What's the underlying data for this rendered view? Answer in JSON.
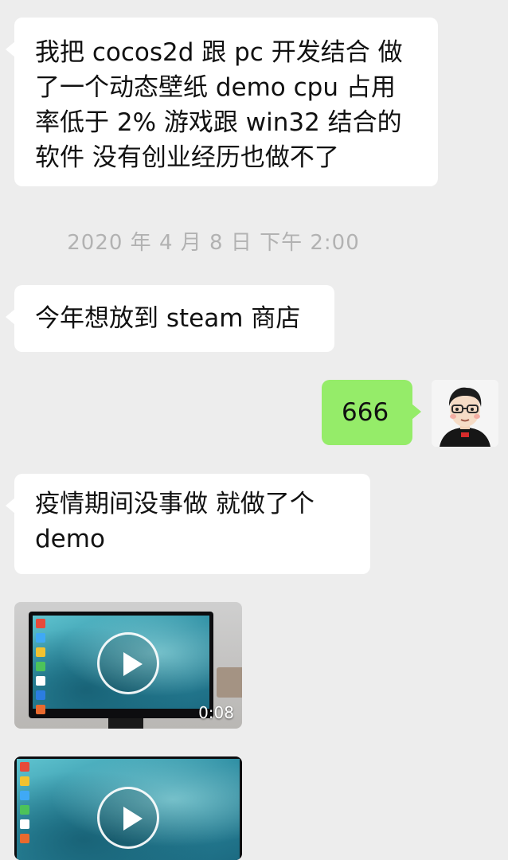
{
  "messages": {
    "msg1_text": "我把 cocos2d 跟 pc 开发结合 做\n了一个动态壁纸 demo cpu 占用\n率低于 2% 游戏跟 win32 结合的\n软件 没有创业经历也做不了",
    "timestamp": "2020 年 4 月 8 日 下午 2:00",
    "msg2_text": "今年想放到 steam 商店",
    "msg3_text": "666",
    "msg4_text": "疫情期间没事做 就做了个\ndemo"
  },
  "videos": [
    {
      "duration": "0:08"
    },
    {
      "duration": ""
    }
  ],
  "colors": {
    "background": "#ededed",
    "incoming_bubble": "#ffffff",
    "outgoing_bubble": "#95ec69",
    "timestamp_text": "#b2b2b2"
  },
  "icons": {
    "play": "play-icon",
    "avatar": "avatar"
  }
}
